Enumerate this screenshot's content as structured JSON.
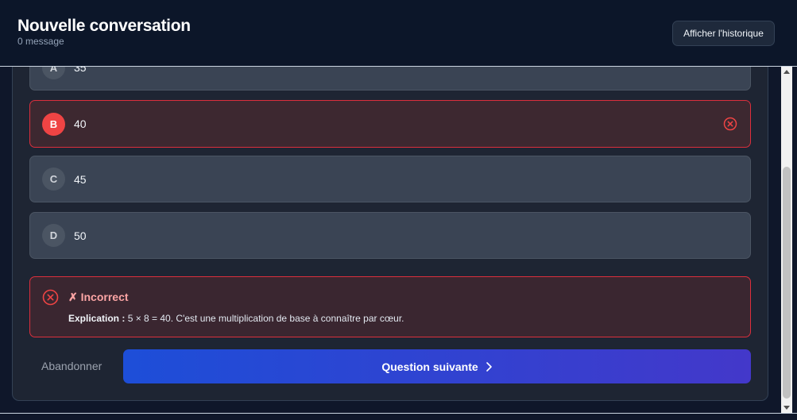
{
  "header": {
    "title": "Nouvelle conversation",
    "subtitle": "0 message",
    "history_button": "Afficher l'historique"
  },
  "quiz": {
    "options": [
      {
        "letter": "A",
        "text": "35",
        "state": "neutral"
      },
      {
        "letter": "B",
        "text": "40",
        "state": "selected-wrong"
      },
      {
        "letter": "C",
        "text": "45",
        "state": "neutral"
      },
      {
        "letter": "D",
        "text": "50",
        "state": "neutral"
      }
    ],
    "feedback": {
      "title": "✗ Incorrect",
      "explanation_label": "Explication :",
      "explanation_text": "5 × 8 = 40. C'est une multiplication de base à connaître par cœur."
    },
    "abandon_label": "Abandonner",
    "next_label": "Question suivante"
  },
  "colors": {
    "background": "#0f172a",
    "error": "#ef4444",
    "button_gradient_start": "#1d4ed8",
    "button_gradient_end": "#4338ca"
  },
  "icons": [
    "x-circle-icon",
    "chevron-right-icon"
  ]
}
